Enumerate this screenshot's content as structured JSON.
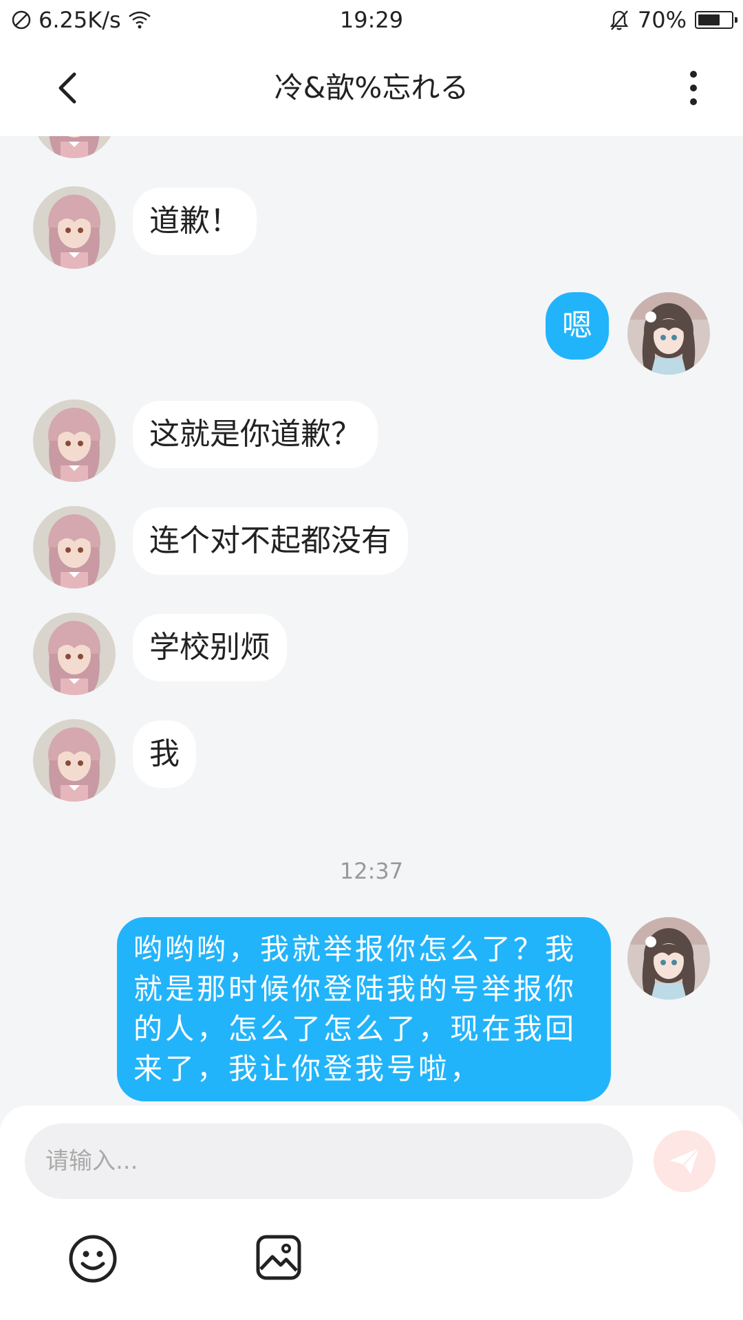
{
  "status_bar": {
    "net_speed": "6.25K/s",
    "time": "19:29",
    "battery": "70%",
    "battery_level": 0.7,
    "icons": [
      "no-sim-icon",
      "wifi-icon",
      "mute-bell-icon",
      "battery-icon"
    ]
  },
  "header": {
    "title": "冷&歆%忘れる",
    "icons": [
      "back-arrow-icon",
      "more-vertical-icon"
    ]
  },
  "messages": [
    {
      "side": "in",
      "text": "道歉！"
    },
    {
      "side": "out",
      "text": "嗯"
    },
    {
      "side": "in",
      "text": "这就是你道歉？"
    },
    {
      "side": "in",
      "text": "连个对不起都没有"
    },
    {
      "side": "in",
      "text": "学校别烦"
    },
    {
      "side": "in",
      "text": "我"
    },
    {
      "side": "time",
      "text": "12:37"
    },
    {
      "side": "out",
      "text": "哟哟哟，我就举报你怎么了？我就是那时候你登陆我的号举报你的人，怎么了怎么了，现在我回来了，我让你登我号啦，"
    }
  ],
  "composer": {
    "placeholder": "请输入...",
    "icons": [
      "send-icon",
      "emoji-icon",
      "image-icon"
    ]
  },
  "colors": {
    "accent": "#22b4fb",
    "background": "#f4f5f7",
    "send_button": "#fde6e3"
  }
}
